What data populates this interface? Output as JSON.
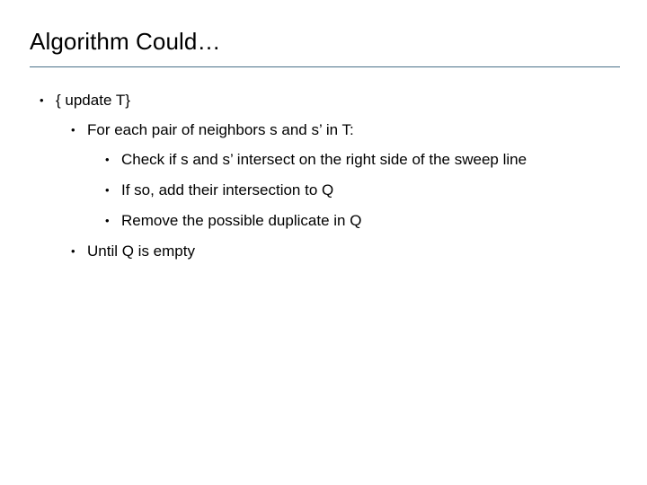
{
  "slide": {
    "title": "Algorithm Could…",
    "bullets": [
      {
        "level": 1,
        "marker": "•",
        "text": "{ update T}"
      },
      {
        "level": 2,
        "marker": "•",
        "text": "For each pair of neighbors s and s’ in T:"
      },
      {
        "level": 3,
        "marker": "•",
        "text": "Check if s and s’ intersect on the right side of the sweep line"
      },
      {
        "level": 3,
        "marker": "•",
        "text": "If so, add their intersection to Q"
      },
      {
        "level": 3,
        "marker": "•",
        "text": "Remove the possible duplicate in Q"
      },
      {
        "level": 2,
        "marker": "•",
        "text": "Until Q is empty"
      }
    ]
  },
  "colors": {
    "title_rule": "#4a7089",
    "text": "#000000",
    "background": "#ffffff"
  }
}
